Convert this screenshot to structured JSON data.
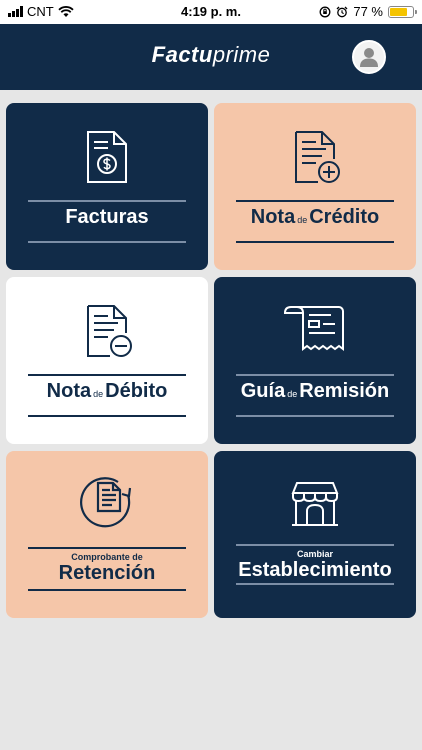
{
  "status_bar": {
    "carrier": "CNT",
    "time": "4:19 p. m.",
    "battery": "77 %",
    "battery_level": 0.77
  },
  "header": {
    "logo_bold": "Factu",
    "logo_light": "prime"
  },
  "tiles": [
    {
      "main": "Facturas"
    },
    {
      "part1": "Nota",
      "small": "de",
      "part2": "Crédito"
    },
    {
      "part1": "Nota",
      "small": "de",
      "part2": "Débito"
    },
    {
      "part1": "Guía",
      "small": "de",
      "part2": "Remisión"
    },
    {
      "small_top": "Comprobante de",
      "main": "Retención"
    },
    {
      "small_top": "Cambiar",
      "main": "Establecimiento"
    }
  ],
  "colors": {
    "navy": "#112b48",
    "peach": "#f5c6a9",
    "white": "#ffffff",
    "background": "#e6e6e6"
  }
}
